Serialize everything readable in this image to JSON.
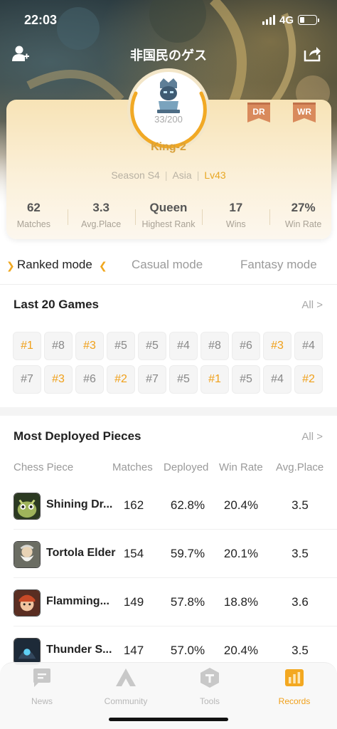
{
  "status_bar": {
    "time": "22:03",
    "network": "4G"
  },
  "header": {
    "title": "非国民のゲス"
  },
  "profile": {
    "rank_progress": "33/200",
    "rank_name": "King-2",
    "badges": [
      "DR",
      "WR"
    ],
    "season": "Season S4",
    "region": "Asia",
    "level": "Lv43",
    "separator": "|"
  },
  "stats": [
    {
      "value": "62",
      "label": "Matches"
    },
    {
      "value": "3.3",
      "label": "Avg.Place"
    },
    {
      "value": "Queen",
      "label": "Highest Rank"
    },
    {
      "value": "17",
      "label": "Wins"
    },
    {
      "value": "27%",
      "label": "Win Rate"
    }
  ],
  "modes": {
    "ranked": "Ranked mode",
    "casual": "Casual mode",
    "fantasy": "Fantasy mode",
    "active": "ranked"
  },
  "last_games": {
    "title": "Last 20 Games",
    "all_label": "All >",
    "results": [
      "#1",
      "#8",
      "#3",
      "#5",
      "#5",
      "#4",
      "#8",
      "#6",
      "#3",
      "#4",
      "#7",
      "#3",
      "#6",
      "#2",
      "#7",
      "#5",
      "#1",
      "#5",
      "#4",
      "#2"
    ]
  },
  "pieces": {
    "title": "Most Deployed Pieces",
    "all_label": "All >",
    "columns": [
      "Chess Piece",
      "Matches",
      "Deployed",
      "Win Rate",
      "Avg.Place"
    ],
    "rows": [
      {
        "name": "Shining Dr...",
        "matches": "162",
        "deployed": "62.8%",
        "win_rate": "20.4%",
        "avg_place": "3.5"
      },
      {
        "name": "Tortola Elder",
        "matches": "154",
        "deployed": "59.7%",
        "win_rate": "20.1%",
        "avg_place": "3.5"
      },
      {
        "name": "Flamming...",
        "matches": "149",
        "deployed": "57.8%",
        "win_rate": "18.8%",
        "avg_place": "3.6"
      },
      {
        "name": "Thunder S...",
        "matches": "147",
        "deployed": "57.0%",
        "win_rate": "20.4%",
        "avg_place": "3.5"
      }
    ]
  },
  "tabbar": {
    "news": "News",
    "community": "Community",
    "tools": "Tools",
    "records": "Records",
    "active": "records"
  },
  "colors": {
    "accent": "#f0a01a",
    "rank_text": "#d8a03a",
    "badge": "#d98a5c"
  }
}
